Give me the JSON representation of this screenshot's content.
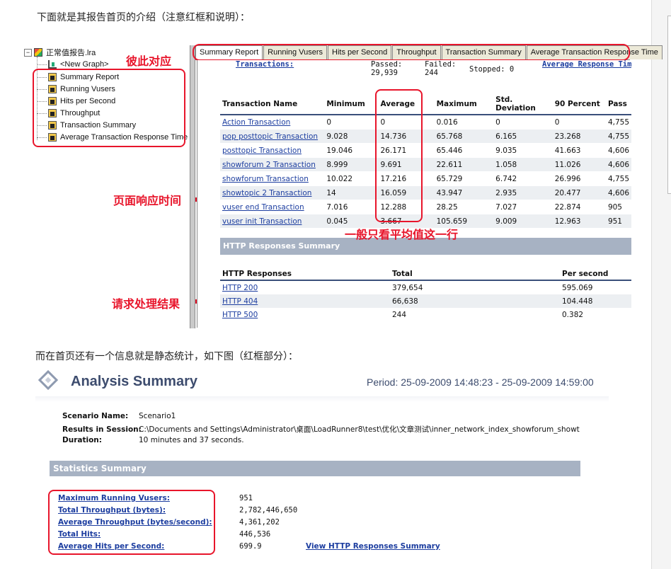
{
  "intro_text": "下面就是其报告首页的介绍（注意红框和说明）：",
  "tree": {
    "root": "正常值报告.lra",
    "new_graph": "<New Graph>",
    "items": [
      "Summary Report",
      "Running Vusers",
      "Hits per Second",
      "Throughput",
      "Transaction Summary",
      "Average Transaction Response Time"
    ]
  },
  "annotations": {
    "pair": "彼此对应",
    "response_time": "页面响应时间",
    "average_note": "一般只看平均值这一行",
    "request_result": "请求处理结果"
  },
  "tabs": [
    "Summary Report",
    "Running Vusers",
    "Hits per Second",
    "Throughput",
    "Transaction Summary",
    "Average Transaction Response Time"
  ],
  "top_strip": {
    "transactions": "Transactions:",
    "passed_label": "Passed:",
    "passed_value": "29,939",
    "failed_label": "Failed:",
    "failed_value": "244",
    "stopped": "Stopped: 0",
    "avg_resp_link": "Average Response Tim"
  },
  "transactions_table": {
    "headers": [
      "Transaction Name",
      "Minimum",
      "Average",
      "Maximum",
      "Std. Deviation",
      "90 Percent",
      "Pass"
    ],
    "rows": [
      [
        "Action Transaction",
        "0",
        "0",
        "0.016",
        "0",
        "0",
        "4,755"
      ],
      [
        "pop posttopic Transaction",
        "9.028",
        "14.736",
        "65.768",
        "6.165",
        "23.268",
        "4,755"
      ],
      [
        "posttopic Transaction",
        "19.046",
        "26.171",
        "65.446",
        "9.035",
        "41.663",
        "4,606"
      ],
      [
        "showforum 2 Transaction",
        "8.999",
        "9.691",
        "22.611",
        "1.058",
        "11.026",
        "4,606"
      ],
      [
        "showforum Transaction",
        "10.022",
        "17.216",
        "65.729",
        "6.742",
        "26.996",
        "4,755"
      ],
      [
        "showtopic 2 Transaction",
        "14",
        "16.059",
        "43.947",
        "2.935",
        "20.477",
        "4,606"
      ],
      [
        "vuser end Transaction",
        "7.016",
        "12.288",
        "28.25",
        "7.027",
        "22.874",
        "905"
      ],
      [
        "vuser init Transaction",
        "0.045",
        "3.667",
        "105.659",
        "9.009",
        "12.963",
        "951"
      ]
    ]
  },
  "http_summary": {
    "title": "HTTP Responses Summary",
    "headers": [
      "HTTP Responses",
      "Total",
      "Per second"
    ],
    "rows": [
      [
        "HTTP 200",
        "379,654",
        "595.069"
      ],
      [
        "HTTP 404",
        "66,638",
        "104.448"
      ],
      [
        "HTTP 500",
        "244",
        "0.382"
      ]
    ]
  },
  "second_intro": "而在首页还有一个信息就是静态统计，如下图（红框部分）：",
  "analysis": {
    "title": "Analysis Summary",
    "period": "Period: 25-09-2009 14:48:23 - 25-09-2009 14:59:00",
    "scenario_label": "Scenario Name:",
    "scenario_value": "Scenario1",
    "results_label": "Results in Session:",
    "results_value": "C:\\Documents and Settings\\Administrator\\桌面\\LoadRunner8\\test\\优化\\文章测试\\inner_network_index_showforum_showt",
    "duration_label": "Duration:",
    "duration_value": "10 minutes and 37 seconds.",
    "stats_title": "Statistics Summary",
    "stats": [
      {
        "label": "Maximum Running Vusers:",
        "value": "951"
      },
      {
        "label": "Total Throughput (bytes):",
        "value": "2,782,446,650"
      },
      {
        "label": "Average Throughput (bytes/second):",
        "value": "4,361,202"
      },
      {
        "label": "Total Hits:",
        "value": "446,536"
      },
      {
        "label": "Average Hits per Second:",
        "value": "699.9"
      }
    ],
    "view_http_link": "View HTTP Responses Summary"
  },
  "colors": {
    "annotation_red": "#e8152b",
    "header_blue": "#3a4f7a",
    "bar_gray_blue": "#a7b2c3",
    "link_blue": "#1d3ea0"
  }
}
